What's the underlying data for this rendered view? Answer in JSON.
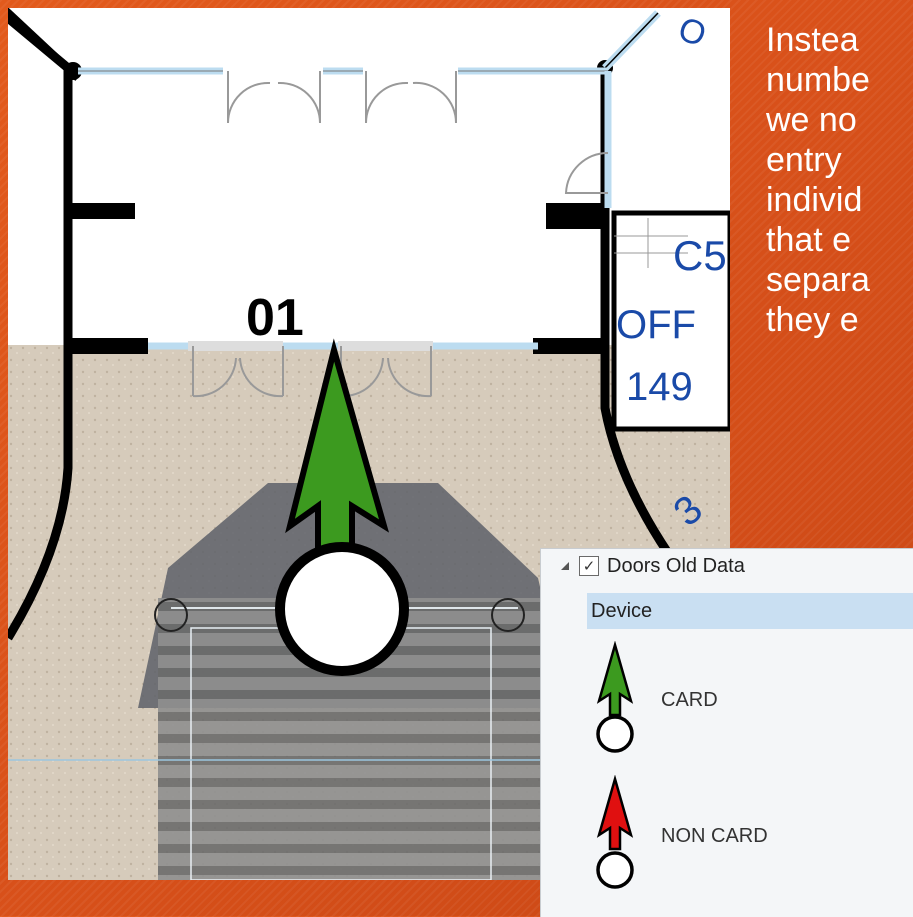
{
  "slide": {
    "text_lines": [
      "Instea",
      "numbe",
      "we no",
      "entry",
      "individ",
      "that e",
      "separa",
      "they e"
    ]
  },
  "floorplan": {
    "door_label": "01",
    "room_label_lines": [
      "C5",
      "OFF",
      "149"
    ],
    "wall_fragments": [
      "O",
      "3"
    ]
  },
  "legend": {
    "layer_name": "Doors Old Data",
    "layer_checked": true,
    "field_header": "Device",
    "classes": [
      {
        "label": "CARD",
        "color": "#3c9a1f"
      },
      {
        "label": "NON CARD",
        "color": "#e01010"
      }
    ]
  },
  "colors": {
    "background": "#d9511a",
    "card_arrow": "#3c9a1f",
    "noncard_arrow": "#e01010",
    "field_header_bg": "#c9dff2",
    "wall_highlight": "#bcdcf0"
  }
}
